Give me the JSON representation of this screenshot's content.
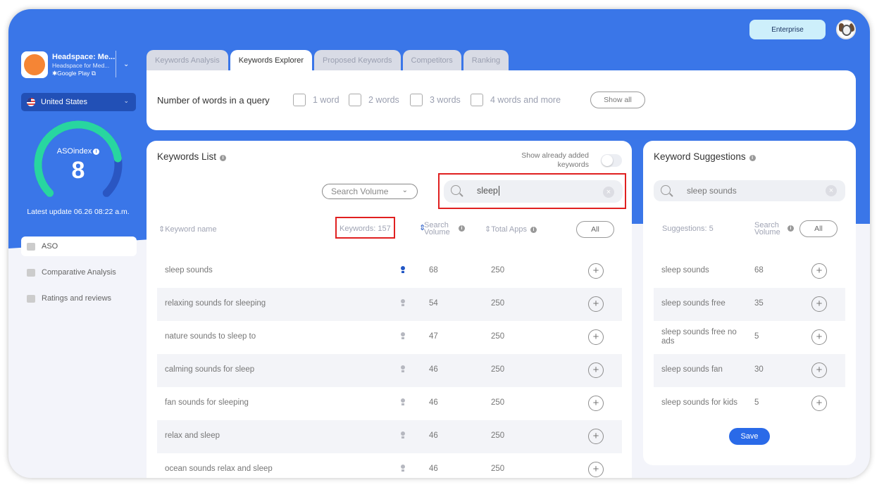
{
  "header": {
    "enterprise_label": "Enterprise"
  },
  "app": {
    "name": "Headspace: Me...",
    "subtitle": "Headspace for Med...",
    "store": "Google Play"
  },
  "country": {
    "label": "United States"
  },
  "aso": {
    "label": "ASOindex",
    "value": "8",
    "score_fraction": 0.8,
    "last_update": "Latest update 06.26 08:22 a.m."
  },
  "nav": {
    "items": [
      {
        "label": "ASO"
      },
      {
        "label": "Comparative Analysis"
      },
      {
        "label": "Ratings and reviews"
      }
    ]
  },
  "tabs": [
    {
      "label": "Keywords Analysis"
    },
    {
      "label": "Keywords Explorer"
    },
    {
      "label": "Proposed Keywords"
    },
    {
      "label": "Competitors"
    },
    {
      "label": "Ranking"
    }
  ],
  "filters": {
    "label": "Number of words in a query",
    "options": [
      "1 word",
      "2 words",
      "3 words",
      "4 words and more"
    ],
    "show_all": "Show all"
  },
  "keywords_list": {
    "title": "Keywords List",
    "show_added_label": "Show already added keywords",
    "sort_label": "Search Volume",
    "search_value": "sleep",
    "columns": {
      "name": "Keyword name",
      "count": "Keywords: 157",
      "volume": "Search Volume",
      "apps": "Total Apps",
      "all": "All"
    },
    "rows": [
      {
        "name": "sleep sounds",
        "volume": "68",
        "apps": "250"
      },
      {
        "name": "relaxing sounds for sleeping",
        "volume": "54",
        "apps": "250"
      },
      {
        "name": "nature sounds to sleep to",
        "volume": "47",
        "apps": "250"
      },
      {
        "name": "calming sounds for sleep",
        "volume": "46",
        "apps": "250"
      },
      {
        "name": "fan sounds for sleeping",
        "volume": "46",
        "apps": "250"
      },
      {
        "name": "relax and sleep",
        "volume": "46",
        "apps": "250"
      },
      {
        "name": "ocean sounds relax and sleep",
        "volume": "46",
        "apps": "250"
      }
    ]
  },
  "suggestions": {
    "title": "Keyword Suggestions",
    "search_value": "sleep sounds",
    "count_label": "Suggestions: 5",
    "volume_label": "Search Volume",
    "all_label": "All",
    "rows": [
      {
        "name": "sleep sounds",
        "volume": "68"
      },
      {
        "name": "sleep sounds free",
        "volume": "35"
      },
      {
        "name": "sleep sounds free no ads",
        "volume": "5"
      },
      {
        "name": "sleep sounds fan",
        "volume": "30"
      },
      {
        "name": "sleep sounds for kids",
        "volume": "5"
      }
    ],
    "save_label": "Save"
  }
}
